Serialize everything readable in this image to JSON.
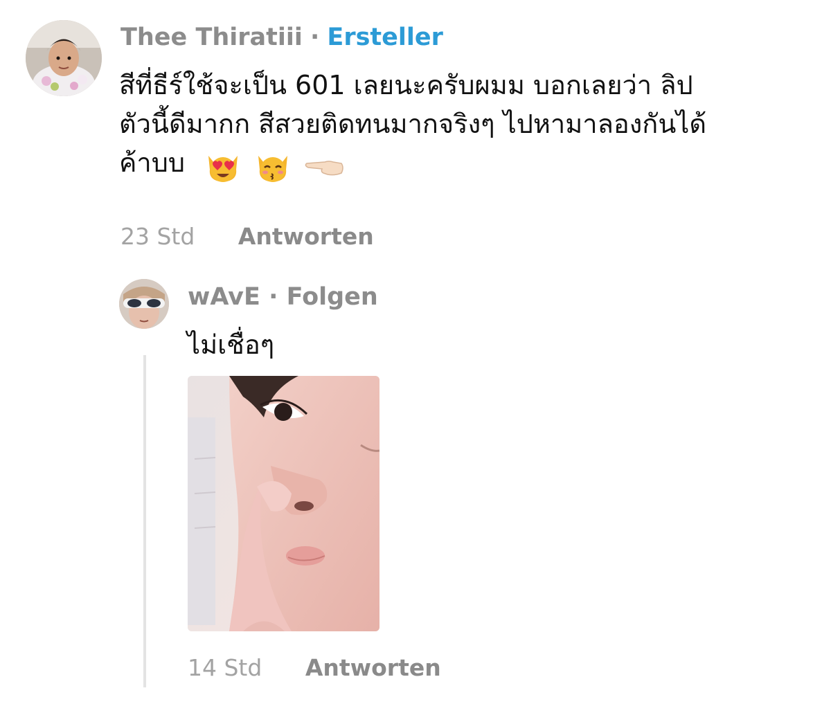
{
  "comment": {
    "author": "Thee Thiratiii",
    "separator": "·",
    "badge": "Ersteller",
    "text_lines": [
      "สีที่ธีร์ใช้จะเป็น 601 เลยนะครับผมม บอกเลยว่า ลิป",
      "ตัวนี้ดีมากก สีสวยติดทนมากจริงๆ ไปหามาลองกันได้",
      "ค้าบบ"
    ],
    "emojis": [
      "heart-eyes-cat-icon",
      "kissing-cat-icon",
      "pointing-left-hand-icon"
    ],
    "time": "23 Std",
    "reply_label": "Antworten"
  },
  "reply": {
    "author": "wAvE",
    "separator": "·",
    "follow_label": "Folgen",
    "text": "ไม่เชื่อๆ",
    "time": "14 Std",
    "reply_label": "Antworten"
  },
  "colors": {
    "muted_text": "#8c8c8c",
    "badge": "#2c9bd6",
    "body_text": "#111111",
    "thread_line": "#e3e3e3"
  }
}
